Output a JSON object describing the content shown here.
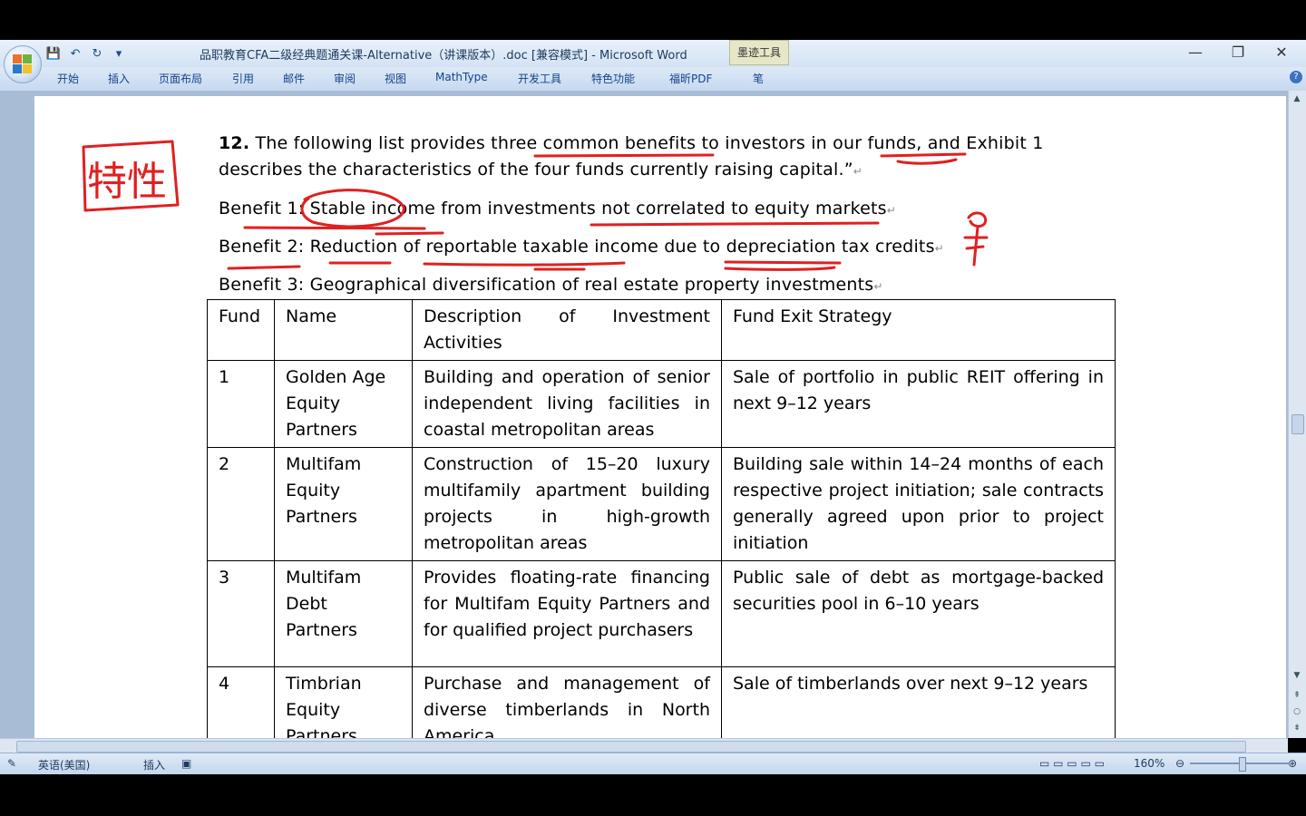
{
  "window": {
    "title": "品职教育CFA二级经典题通关课-Alternative（讲课版本）.doc [兼容模式] - Microsoft Word",
    "ink_tools_label": "墨迹工具",
    "controls": {
      "minimize": "—",
      "restore": "❐",
      "close": "✕"
    }
  },
  "qat": [
    "💾",
    "↶",
    "↻",
    "▾"
  ],
  "ribbon_tabs": [
    "开始",
    "插入",
    "页面布局",
    "引用",
    "邮件",
    "审阅",
    "视图",
    "MathType",
    "开发工具",
    "特色功能",
    "福昕PDF",
    "笔"
  ],
  "document": {
    "question_number": "12.",
    "intro_line1": " The  following  list  provides  three  common  benefits  to  investors  in  our  funds,  and  Exhibit 1",
    "intro_line2": "describes the characteristics of the four funds currently raising capital.”",
    "benefit1": "Benefit 1: Stable income from investments not correlated to equity markets",
    "benefit2": "Benefit 2: Reduction of reportable taxable income due to depreciation tax credits",
    "benefit3": "Benefit 3: Geographical diversification of real estate property investments",
    "paragraph_mark": "↵",
    "table": {
      "headers": [
        "Fund",
        "Name",
        "Description of Investment Activities",
        "Fund Exit Strategy"
      ],
      "rows": [
        [
          "1",
          "Golden Age Equity Partners",
          "Building and operation of senior independent living facilities in coastal metropolitan areas",
          "Sale of portfolio in public REIT offering in next 9–12 years"
        ],
        [
          "2",
          "Multifam Equity Partners",
          "Construction of 15–20 luxury multifamily apartment building projects in high-growth metropolitan areas",
          "Building sale within 14–24 months of each respective project initiation; sale contracts generally agreed upon prior to project initiation"
        ],
        [
          "3",
          "Multifam Debt Partners",
          "Provides floating-rate financing for Multifam Equity Partners and for qualified project purchasers",
          "Public sale of debt as mortgage-backed securities pool in 6–10 years"
        ],
        [
          "4",
          "Timbrian Equity Partners",
          "Purchase and management of diverse timberlands in North America",
          "Sale of timberlands over next 9–12 years"
        ]
      ]
    }
  },
  "annotation_text": "特性",
  "status_bar": {
    "language": "英语(美国)",
    "mode": "插入",
    "zoom": "160%"
  },
  "colors": {
    "ink": "#e02020",
    "ribbon": "#c6d9f0",
    "page": "#ffffff"
  }
}
